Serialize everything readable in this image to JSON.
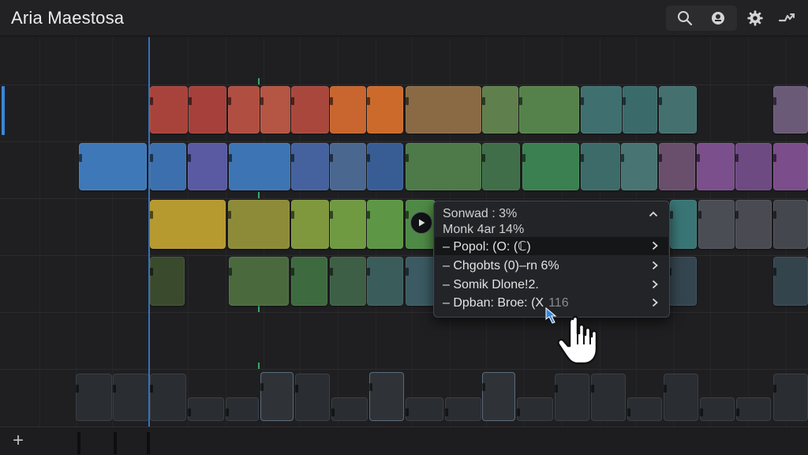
{
  "app": {
    "title": "Aria Maestosa"
  },
  "toolbar": {
    "search": "search-icon",
    "record": "record-icon",
    "settings": "gear-icon",
    "export": "export-icon"
  },
  "context_menu": {
    "info_line_1": "Sonwad : 3%",
    "info_line_2": "Monk 4ar 14%",
    "items": [
      {
        "label": "– Popol: (O: (ℂ)",
        "selected": true
      },
      {
        "label": "– Chgobts (0)–rn 6%",
        "selected": false
      },
      {
        "label": "– Somik Dlone!2.",
        "selected": false
      },
      {
        "label": "– Dpban: Broe: (X",
        "extra": "116",
        "selected": false
      }
    ]
  },
  "bottombar": {
    "add_label": "+"
  },
  "colors": {
    "accent": "#3b86d8",
    "red": "#a8433c",
    "orange": "#c9652e",
    "brown": "#8a6a45",
    "green": "#5a8a4a",
    "teal": "#3f6f6e",
    "blue": "#3f78b8",
    "purple": "#7a4f8c",
    "yellow": "#b6992f"
  }
}
